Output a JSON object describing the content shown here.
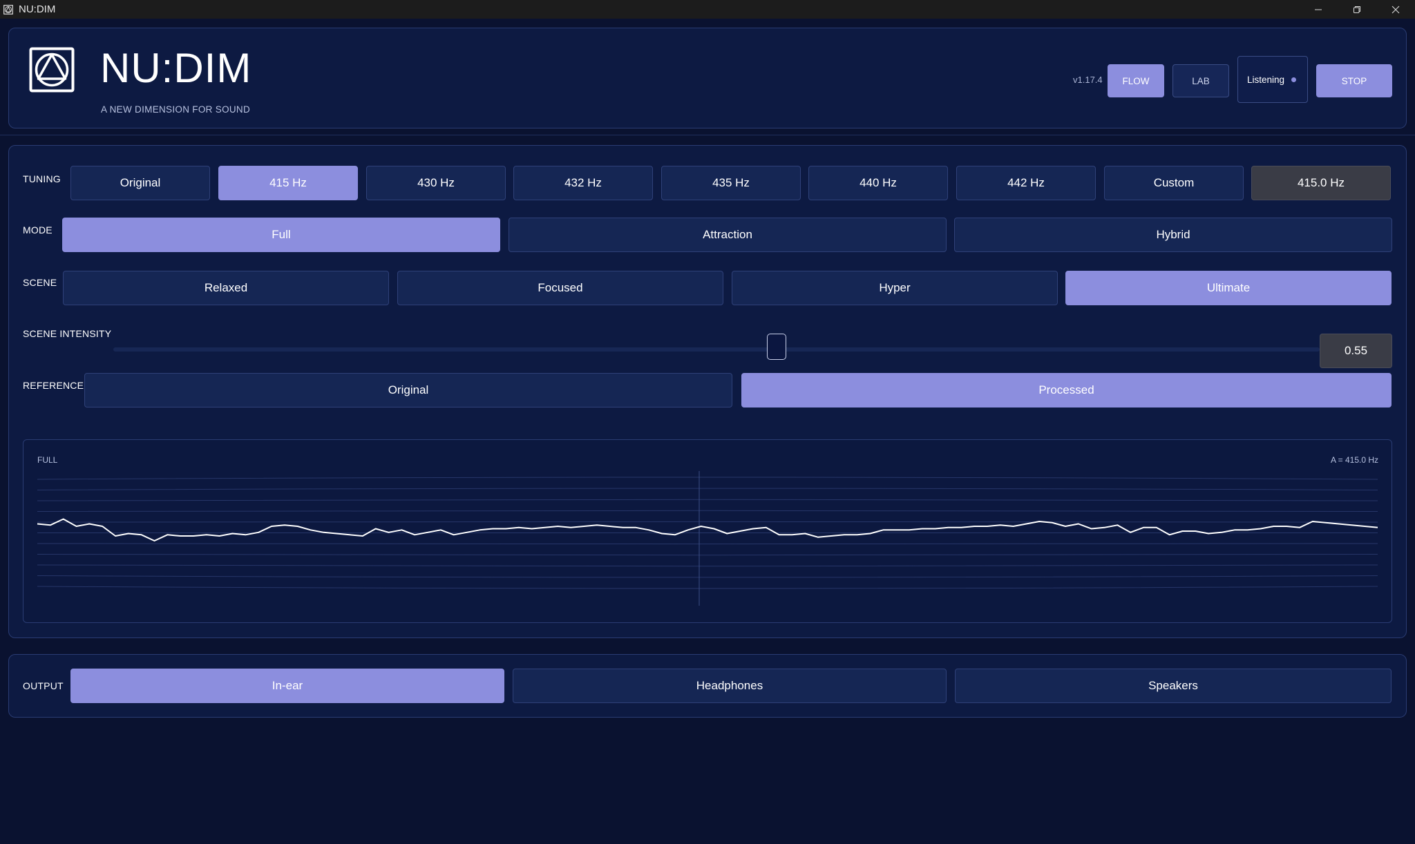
{
  "window": {
    "title": "NU:DIM",
    "controls": [
      "minimize-icon",
      "restore-icon",
      "close-icon"
    ]
  },
  "header": {
    "title": "NU:DIM",
    "subtitle": "A NEW DIMENSION FOR SOUND",
    "version": "v1.17.4",
    "flow_label": "FLOW",
    "lab_label": "LAB",
    "listening_label": "Listening",
    "stop_label": "STOP",
    "active_view": "FLOW"
  },
  "tuning": {
    "label": "TUNING",
    "options": [
      "Original",
      "415 Hz",
      "430 Hz",
      "432 Hz",
      "435 Hz",
      "440 Hz",
      "442 Hz",
      "Custom"
    ],
    "selected": "415 Hz",
    "readout": "415.0 Hz"
  },
  "mode": {
    "label": "MODE",
    "options": [
      "Full",
      "Attraction",
      "Hybrid"
    ],
    "selected": "Full"
  },
  "scene": {
    "label": "SCENE",
    "options": [
      "Relaxed",
      "Focused",
      "Hyper",
      "Ultimate"
    ],
    "selected": "Ultimate"
  },
  "scene_intensity": {
    "label": "SCENE INTENSITY",
    "value": 0.55,
    "value_text": "0.55"
  },
  "reference": {
    "label": "REFERENCE",
    "options": [
      "Original",
      "Processed"
    ],
    "selected": "Processed"
  },
  "visualizer": {
    "mode_label": "FULL",
    "readout": "A = 415.0 Hz",
    "trace": [
      0.38,
      0.39,
      0.34,
      0.4,
      0.38,
      0.4,
      0.48,
      0.46,
      0.47,
      0.52,
      0.47,
      0.48,
      0.48,
      0.47,
      0.48,
      0.46,
      0.47,
      0.45,
      0.4,
      0.39,
      0.4,
      0.43,
      0.45,
      0.46,
      0.47,
      0.48,
      0.42,
      0.45,
      0.43,
      0.47,
      0.45,
      0.43,
      0.47,
      0.45,
      0.43,
      0.42,
      0.42,
      0.41,
      0.42,
      0.41,
      0.4,
      0.41,
      0.4,
      0.39,
      0.4,
      0.41,
      0.41,
      0.43,
      0.46,
      0.47,
      0.43,
      0.4,
      0.42,
      0.46,
      0.44,
      0.42,
      0.41,
      0.47,
      0.47,
      0.46,
      0.49,
      0.48,
      0.47,
      0.47,
      0.46,
      0.43,
      0.43,
      0.43,
      0.42,
      0.42,
      0.41,
      0.41,
      0.4,
      0.4,
      0.39,
      0.4,
      0.38,
      0.36,
      0.37,
      0.4,
      0.38,
      0.42,
      0.41,
      0.39,
      0.45,
      0.41,
      0.41,
      0.47,
      0.44,
      0.44,
      0.46,
      0.45,
      0.43,
      0.43,
      0.42,
      0.4,
      0.4,
      0.41,
      0.36,
      0.37,
      0.38,
      0.39,
      0.4,
      0.41
    ],
    "color_trace": "#ffffff",
    "color_grid": "#2a3a6e"
  },
  "output": {
    "label": "OUTPUT",
    "options": [
      "In-ear",
      "Headphones",
      "Speakers"
    ],
    "selected": "In-ear"
  },
  "colors": {
    "accent": "#8c8ede",
    "background": "#0a1230",
    "panel": "#0d1a42",
    "button": "#152654"
  }
}
